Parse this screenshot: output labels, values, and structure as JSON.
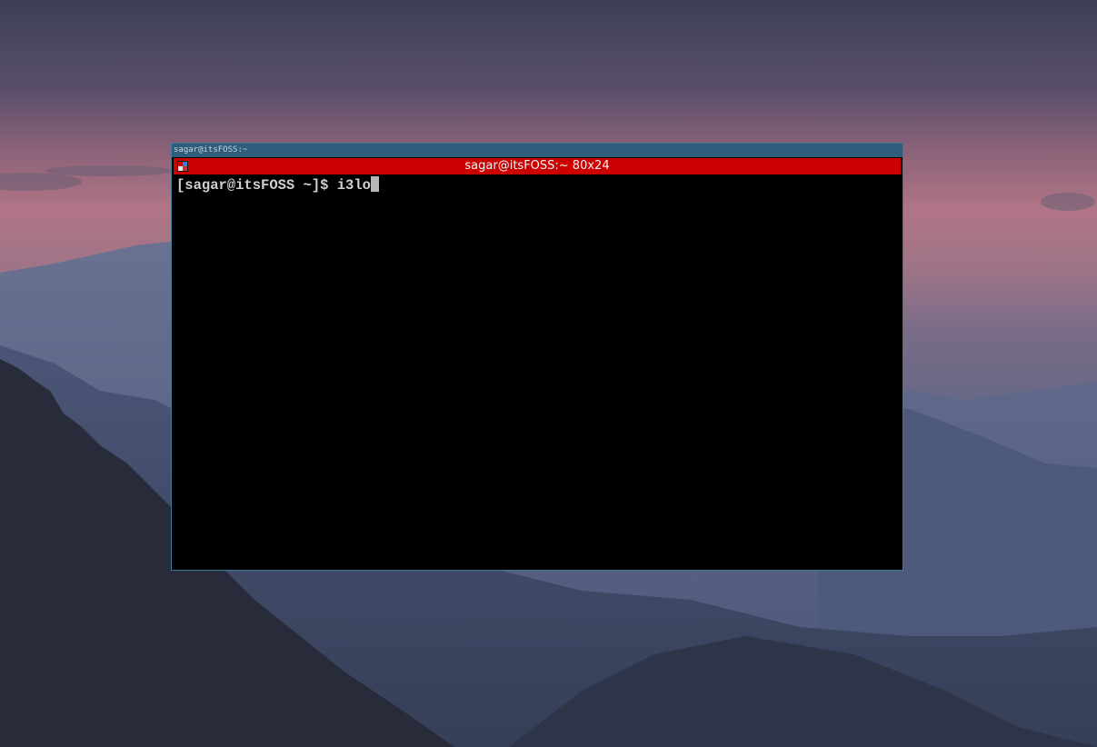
{
  "desktop": {
    "wallpaper": "mountain-dusk-landscape",
    "colors": {
      "sky_top": "#3b3f58",
      "sky_pink": "#b77585",
      "mountain_far": "#5a6585",
      "mountain_mid": "#3e4761",
      "mountain_near": "#262a39"
    }
  },
  "window": {
    "wm_title": "sagar@itsFOSS:~",
    "term_title": "sagar@itsFOSS:~ 80x24",
    "icon": "xterm-icon",
    "prompt": "[sagar@itsFOSS ~]$ ",
    "input": "i3lo",
    "colors": {
      "wm_titlebar": "#2f5d7c",
      "term_titlebar": "#cc0000",
      "background": "#000000",
      "foreground": "#d0d0d0"
    }
  }
}
